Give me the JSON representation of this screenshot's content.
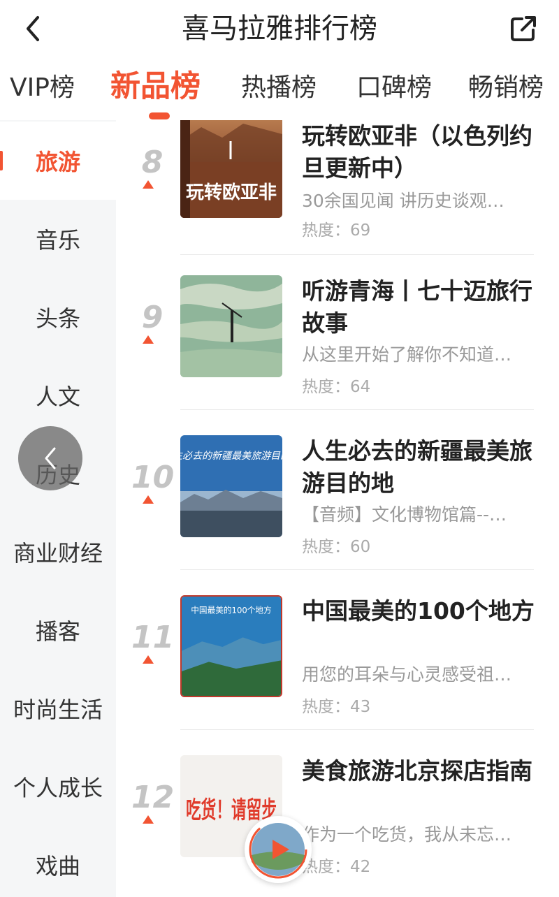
{
  "header": {
    "title": "喜马拉雅排行榜"
  },
  "tabs": [
    {
      "label": "VIP榜",
      "active": false
    },
    {
      "label": "新品榜",
      "active": true
    },
    {
      "label": "热播榜",
      "active": false
    },
    {
      "label": "口碑榜",
      "active": false
    },
    {
      "label": "畅销榜",
      "active": false
    }
  ],
  "sidebar": {
    "items": [
      {
        "label": "旅游",
        "active": true
      },
      {
        "label": "音乐"
      },
      {
        "label": "头条"
      },
      {
        "label": "人文"
      },
      {
        "label": "历史"
      },
      {
        "label": "商业财经"
      },
      {
        "label": "播客"
      },
      {
        "label": "时尚生活"
      },
      {
        "label": "个人成长"
      },
      {
        "label": "戏曲"
      }
    ]
  },
  "list": {
    "items": [
      {
        "rank": "8",
        "title": "玩转欧亚非（以色列约旦更新中）",
        "desc": "30余国见闻 讲历史谈观…",
        "heat": "热度：69",
        "cover_text": "玩转欧亚非"
      },
      {
        "rank": "9",
        "title": "听游青海丨七十迈旅行故事",
        "desc": "从这里开始了解你不知道…",
        "heat": "热度：64"
      },
      {
        "rank": "10",
        "title": "人生必去的新疆最美旅游目的地",
        "desc": "【音频】文化博物馆篇--…",
        "heat": "热度：60",
        "cover_text": "人生必去的新疆最美旅游目的地"
      },
      {
        "rank": "11",
        "title": "中国最美的100个地方",
        "desc": "用您的耳朵与心灵感受祖…",
        "heat": "热度：43",
        "cover_text": "中国最美的100个地方"
      },
      {
        "rank": "12",
        "title": "美食旅游北京探店指南",
        "desc": "作为一个吃货，我从未忘…",
        "heat": "热度：42",
        "cover_text": "吃货！请留步"
      }
    ]
  },
  "colors": {
    "accent": "#f25432",
    "sidebar_bg": "#f5f6f7"
  },
  "icons": {
    "back": "chevron-left-icon",
    "share": "share-external-icon",
    "float_back": "chevron-left-icon",
    "player": "play-icon"
  }
}
